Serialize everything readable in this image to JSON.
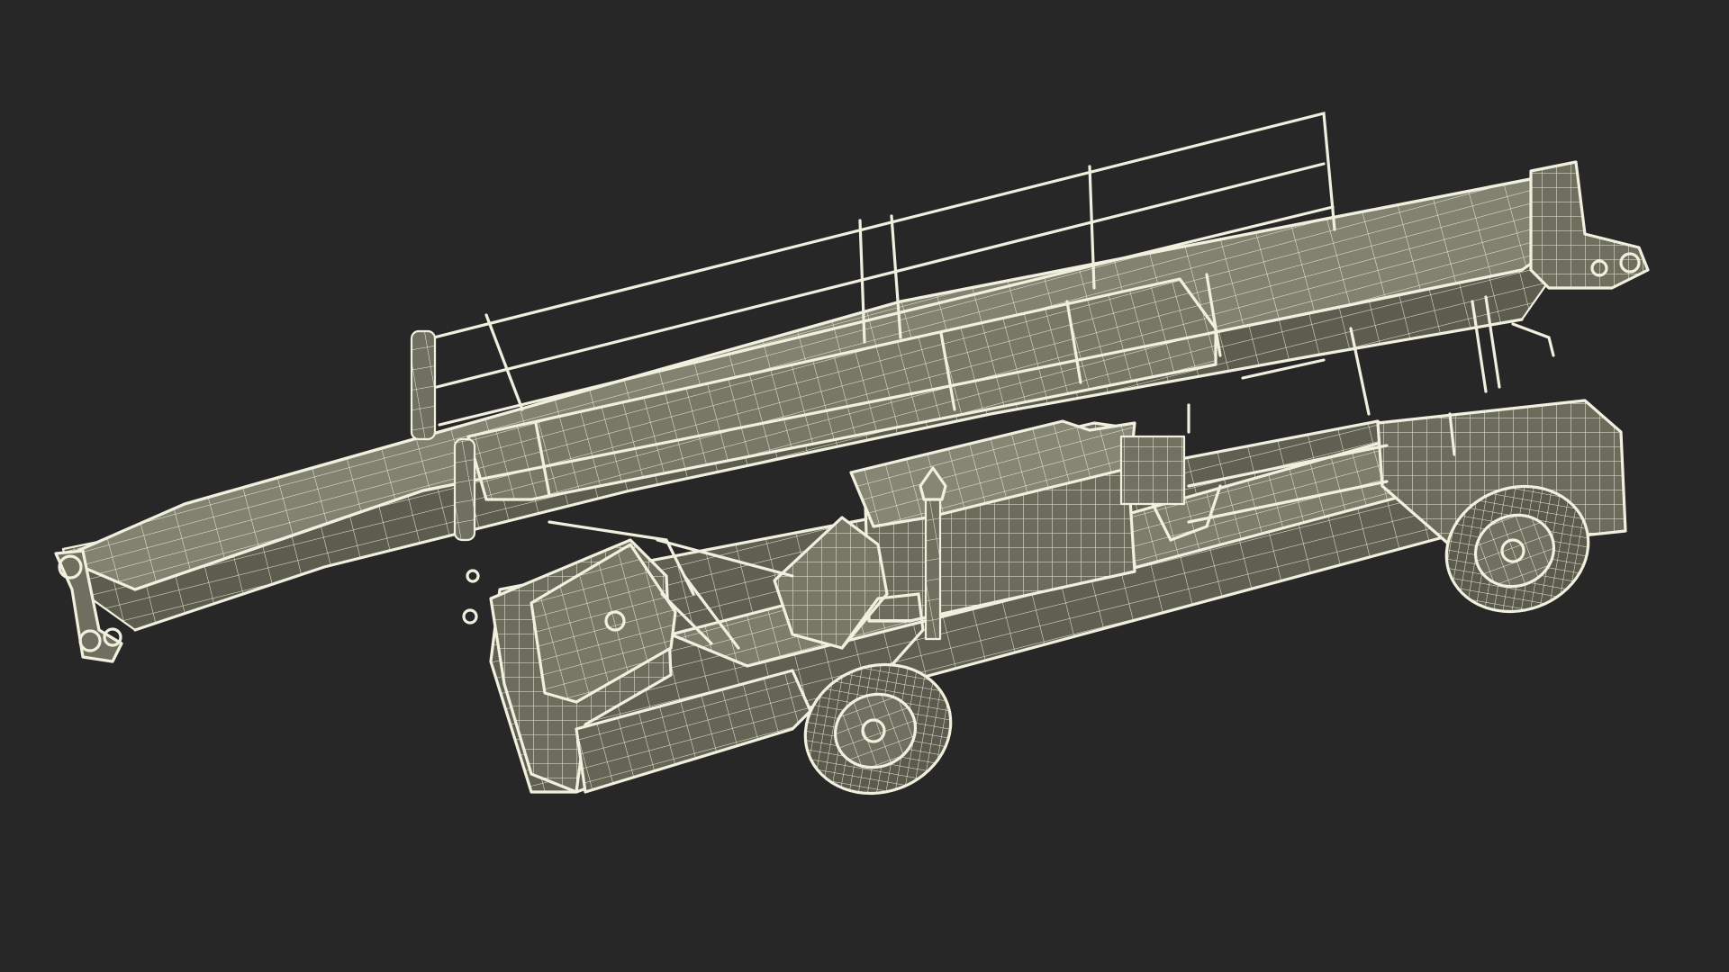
{
  "scene": {
    "background_color": "#272727",
    "body_color": "#6f705f",
    "body_dark_color": "#5a5b4d",
    "body_light_color": "#838471",
    "wire_color": "#f1f0df"
  }
}
